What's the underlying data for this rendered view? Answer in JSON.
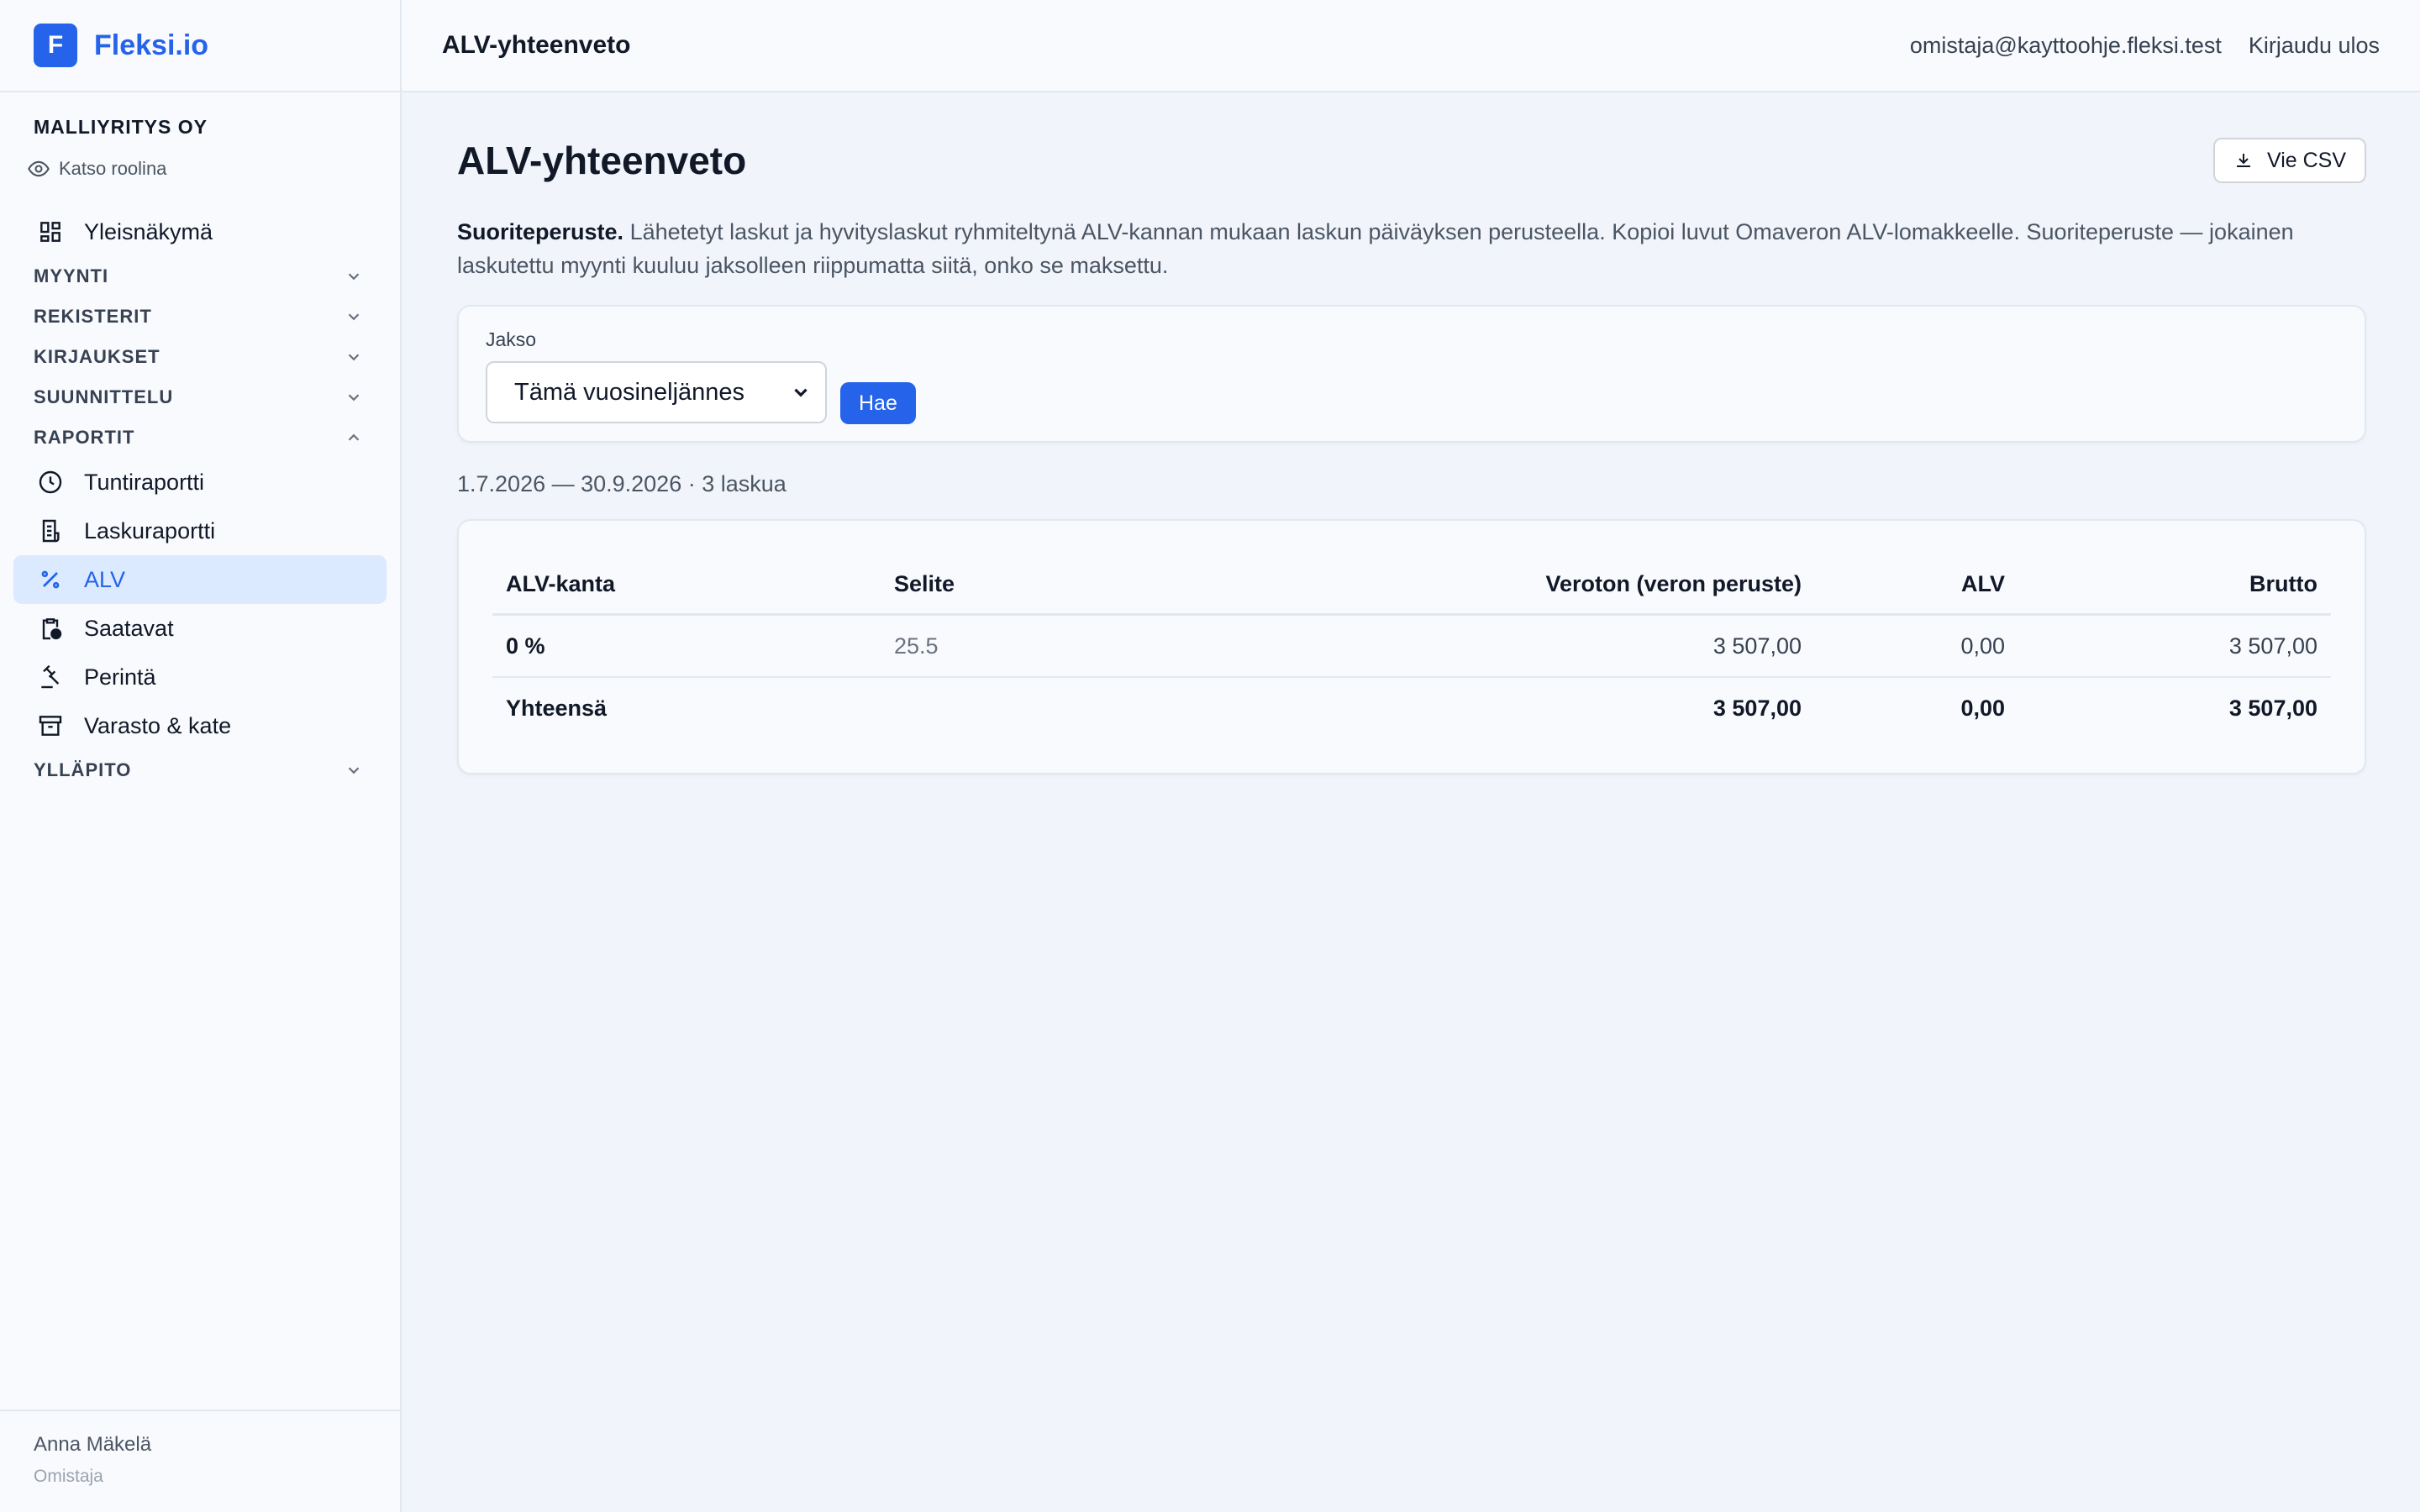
{
  "brand": {
    "logo_letter": "F",
    "name": "Fleksi.io"
  },
  "company": {
    "name": "MALLIYRITYS OY",
    "view_role": "Katso roolina"
  },
  "nav": {
    "overview": "Yleisnäkymä",
    "groups": {
      "sales": "MYYNTI",
      "registers": "REKISTERIT",
      "entries": "KIRJAUKSET",
      "planning": "SUUNNITTELU",
      "reports": "RAPORTIT",
      "maintenance": "YLLÄPITO"
    },
    "reports": {
      "hours": "Tuntiraportti",
      "invoices": "Laskuraportti",
      "vat": "ALV",
      "receivables": "Saatavat",
      "collection": "Perintä",
      "inventory": "Varasto & kate"
    }
  },
  "user": {
    "name": "Anna Mäkelä",
    "role": "Omistaja"
  },
  "topbar": {
    "title": "ALV-yhteenveto",
    "email": "omistaja@kayttoohje.fleksi.test",
    "logout": "Kirjaudu ulos"
  },
  "page": {
    "title": "ALV-yhteenveto",
    "export_button": "Vie CSV",
    "description_bold": "Suoriteperuste.",
    "description": "Lähetetyt laskut ja hyvityslaskut ryhmiteltynä ALV-kannan mukaan laskun päiväyksen perusteella. Kopioi luvut Omaveron ALV-lomakkeelle. Suoriteperuste — jokainen laskutettu myynti kuuluu jaksolleen riippumatta siitä, onko se maksettu.",
    "filter": {
      "label": "Jakso",
      "selected": "Tämä vuosineljännes",
      "submit": "Hae"
    },
    "period_summary": "1.7.2026 — 30.9.2026 · 3 laskua"
  },
  "table": {
    "headers": {
      "rate": "ALV-kanta",
      "description": "Selite",
      "net": "Veroton (veron peruste)",
      "vat": "ALV",
      "gross": "Brutto"
    },
    "rows": [
      {
        "rate": "0 %",
        "description": "25.5",
        "net": "3 507,00",
        "vat": "0,00",
        "gross": "3 507,00"
      }
    ],
    "total": {
      "label": "Yhteensä",
      "net": "3 507,00",
      "vat": "0,00",
      "gross": "3 507,00"
    }
  },
  "colors": {
    "accent": "#2563eb",
    "active_bg": "#dbeafe",
    "background": "#f1f5fb"
  }
}
